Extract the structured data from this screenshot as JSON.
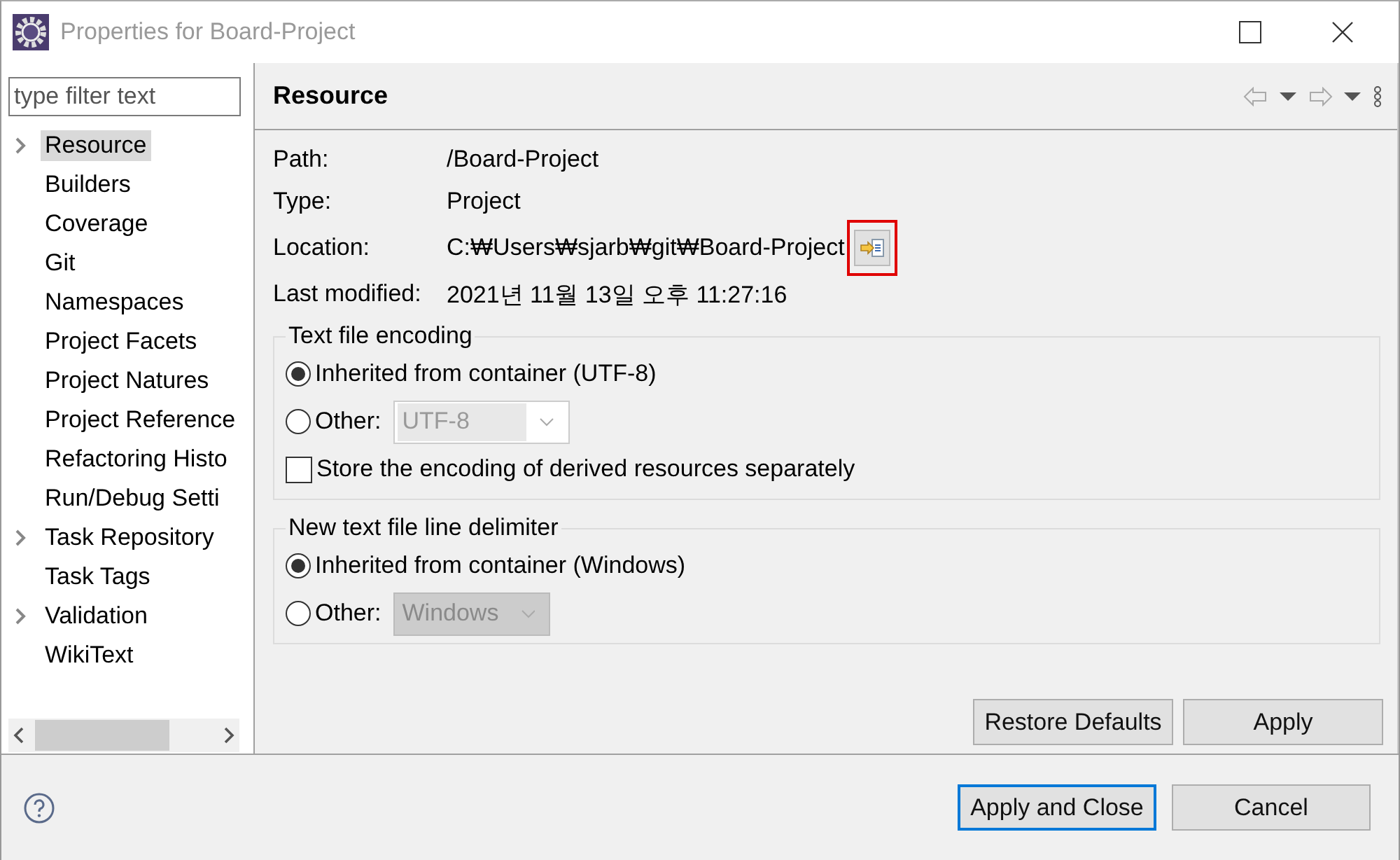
{
  "window": {
    "title": "Properties for Board-Project"
  },
  "filter": {
    "placeholder": "type filter text"
  },
  "tree": [
    {
      "label": "Resource",
      "expandable": true,
      "selected": true
    },
    {
      "label": "Builders",
      "expandable": false,
      "selected": false
    },
    {
      "label": "Coverage",
      "expandable": false,
      "selected": false
    },
    {
      "label": "Git",
      "expandable": false,
      "selected": false
    },
    {
      "label": "Namespaces",
      "expandable": false,
      "selected": false
    },
    {
      "label": "Project Facets",
      "expandable": false,
      "selected": false
    },
    {
      "label": "Project Natures",
      "expandable": false,
      "selected": false
    },
    {
      "label": "Project Reference",
      "expandable": false,
      "selected": false
    },
    {
      "label": "Refactoring Histo",
      "expandable": false,
      "selected": false
    },
    {
      "label": "Run/Debug Setti",
      "expandable": false,
      "selected": false
    },
    {
      "label": "Task Repository",
      "expandable": true,
      "selected": false
    },
    {
      "label": "Task Tags",
      "expandable": false,
      "selected": false
    },
    {
      "label": "Validation",
      "expandable": true,
      "selected": false
    },
    {
      "label": "WikiText",
      "expandable": false,
      "selected": false
    }
  ],
  "page": {
    "title": "Resource"
  },
  "info": [
    {
      "kind": "text",
      "label": "Path:",
      "value": "/Board-Project"
    },
    {
      "kind": "text",
      "label": "Type:",
      "value": "Project"
    },
    {
      "kind": "location",
      "label": "Location:",
      "value": "C:₩Users₩sjarb₩git₩Board-Project",
      "highlighted": true
    },
    {
      "kind": "text",
      "label": "Last modified:",
      "value": "2021년 11월 13일 오후 11:27:16"
    }
  ],
  "groups": [
    {
      "title": "Text file encoding",
      "options": [
        {
          "kind": "radio",
          "label": "Inherited from container (UTF-8)",
          "selected": true
        },
        {
          "kind": "radio",
          "label": "Other:",
          "selected": false,
          "combo": "UTF-8"
        },
        {
          "kind": "checkbox",
          "label": "Store the encoding of derived resources separately",
          "checked": false
        }
      ]
    },
    {
      "title": "New text file line delimiter",
      "options": [
        {
          "kind": "radio",
          "label": "Inherited from container (Windows)",
          "selected": true
        },
        {
          "kind": "radio",
          "label": "Other:",
          "selected": false,
          "combo": "Windows"
        }
      ]
    }
  ],
  "page_buttons": [
    "Restore Defaults",
    "Apply"
  ],
  "footer_buttons": [
    {
      "label": "Apply and Close",
      "default": true
    },
    {
      "label": "Cancel",
      "default": false
    }
  ]
}
